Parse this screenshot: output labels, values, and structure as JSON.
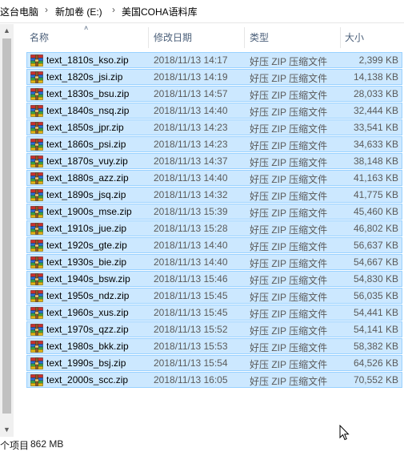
{
  "breadcrumb": {
    "items": [
      "这台电脑",
      "新加卷 (E:)",
      "美国COHA语料库"
    ],
    "separator": "›"
  },
  "columns": {
    "name": "名称",
    "date": "修改日期",
    "type": "类型",
    "size": "大小",
    "sort_indicator": "˄"
  },
  "files": [
    {
      "name": "text_1810s_kso.zip",
      "date": "2018/11/13 14:17",
      "type": "好压 ZIP 压缩文件",
      "size": "2,399 KB"
    },
    {
      "name": "text_1820s_jsi.zip",
      "date": "2018/11/13 14:19",
      "type": "好压 ZIP 压缩文件",
      "size": "14,138 KB"
    },
    {
      "name": "text_1830s_bsu.zip",
      "date": "2018/11/13 14:57",
      "type": "好压 ZIP 压缩文件",
      "size": "28,033 KB"
    },
    {
      "name": "text_1840s_nsq.zip",
      "date": "2018/11/13 14:40",
      "type": "好压 ZIP 压缩文件",
      "size": "32,444 KB"
    },
    {
      "name": "text_1850s_jpr.zip",
      "date": "2018/11/13 14:23",
      "type": "好压 ZIP 压缩文件",
      "size": "33,541 KB"
    },
    {
      "name": "text_1860s_psi.zip",
      "date": "2018/11/13 14:23",
      "type": "好压 ZIP 压缩文件",
      "size": "34,633 KB"
    },
    {
      "name": "text_1870s_vuy.zip",
      "date": "2018/11/13 14:37",
      "type": "好压 ZIP 压缩文件",
      "size": "38,148 KB"
    },
    {
      "name": "text_1880s_azz.zip",
      "date": "2018/11/13 14:40",
      "type": "好压 ZIP 压缩文件",
      "size": "41,163 KB"
    },
    {
      "name": "text_1890s_jsq.zip",
      "date": "2018/11/13 14:32",
      "type": "好压 ZIP 压缩文件",
      "size": "41,775 KB"
    },
    {
      "name": "text_1900s_mse.zip",
      "date": "2018/11/13 15:39",
      "type": "好压 ZIP 压缩文件",
      "size": "45,460 KB"
    },
    {
      "name": "text_1910s_jue.zip",
      "date": "2018/11/13 15:28",
      "type": "好压 ZIP 压缩文件",
      "size": "46,802 KB"
    },
    {
      "name": "text_1920s_gte.zip",
      "date": "2018/11/13 14:40",
      "type": "好压 ZIP 压缩文件",
      "size": "56,637 KB"
    },
    {
      "name": "text_1930s_bie.zip",
      "date": "2018/11/13 14:40",
      "type": "好压 ZIP 压缩文件",
      "size": "54,667 KB"
    },
    {
      "name": "text_1940s_bsw.zip",
      "date": "2018/11/13 15:46",
      "type": "好压 ZIP 压缩文件",
      "size": "54,830 KB"
    },
    {
      "name": "text_1950s_ndz.zip",
      "date": "2018/11/13 15:45",
      "type": "好压 ZIP 压缩文件",
      "size": "56,035 KB"
    },
    {
      "name": "text_1960s_xus.zip",
      "date": "2018/11/13 15:45",
      "type": "好压 ZIP 压缩文件",
      "size": "54,441 KB"
    },
    {
      "name": "text_1970s_qzz.zip",
      "date": "2018/11/13 15:52",
      "type": "好压 ZIP 压缩文件",
      "size": "54,141 KB"
    },
    {
      "name": "text_1980s_bkk.zip",
      "date": "2018/11/13 15:53",
      "type": "好压 ZIP 压缩文件",
      "size": "58,382 KB"
    },
    {
      "name": "text_1990s_bsj.zip",
      "date": "2018/11/13 15:54",
      "type": "好压 ZIP 压缩文件",
      "size": "64,526 KB"
    },
    {
      "name": "text_2000s_scc.zip",
      "date": "2018/11/13 16:05",
      "type": "好压 ZIP 压缩文件",
      "size": "70,552 KB"
    }
  ],
  "status": {
    "item_count": "个项目",
    "selected_size": "862 MB"
  },
  "icons": {
    "file": "zip-archive-icon",
    "scroll_up": "▲",
    "scroll_down": "▼"
  },
  "colors": {
    "selection_bg": "#cce8ff",
    "selection_border": "#99d1ff",
    "header_text": "#4c607a"
  }
}
